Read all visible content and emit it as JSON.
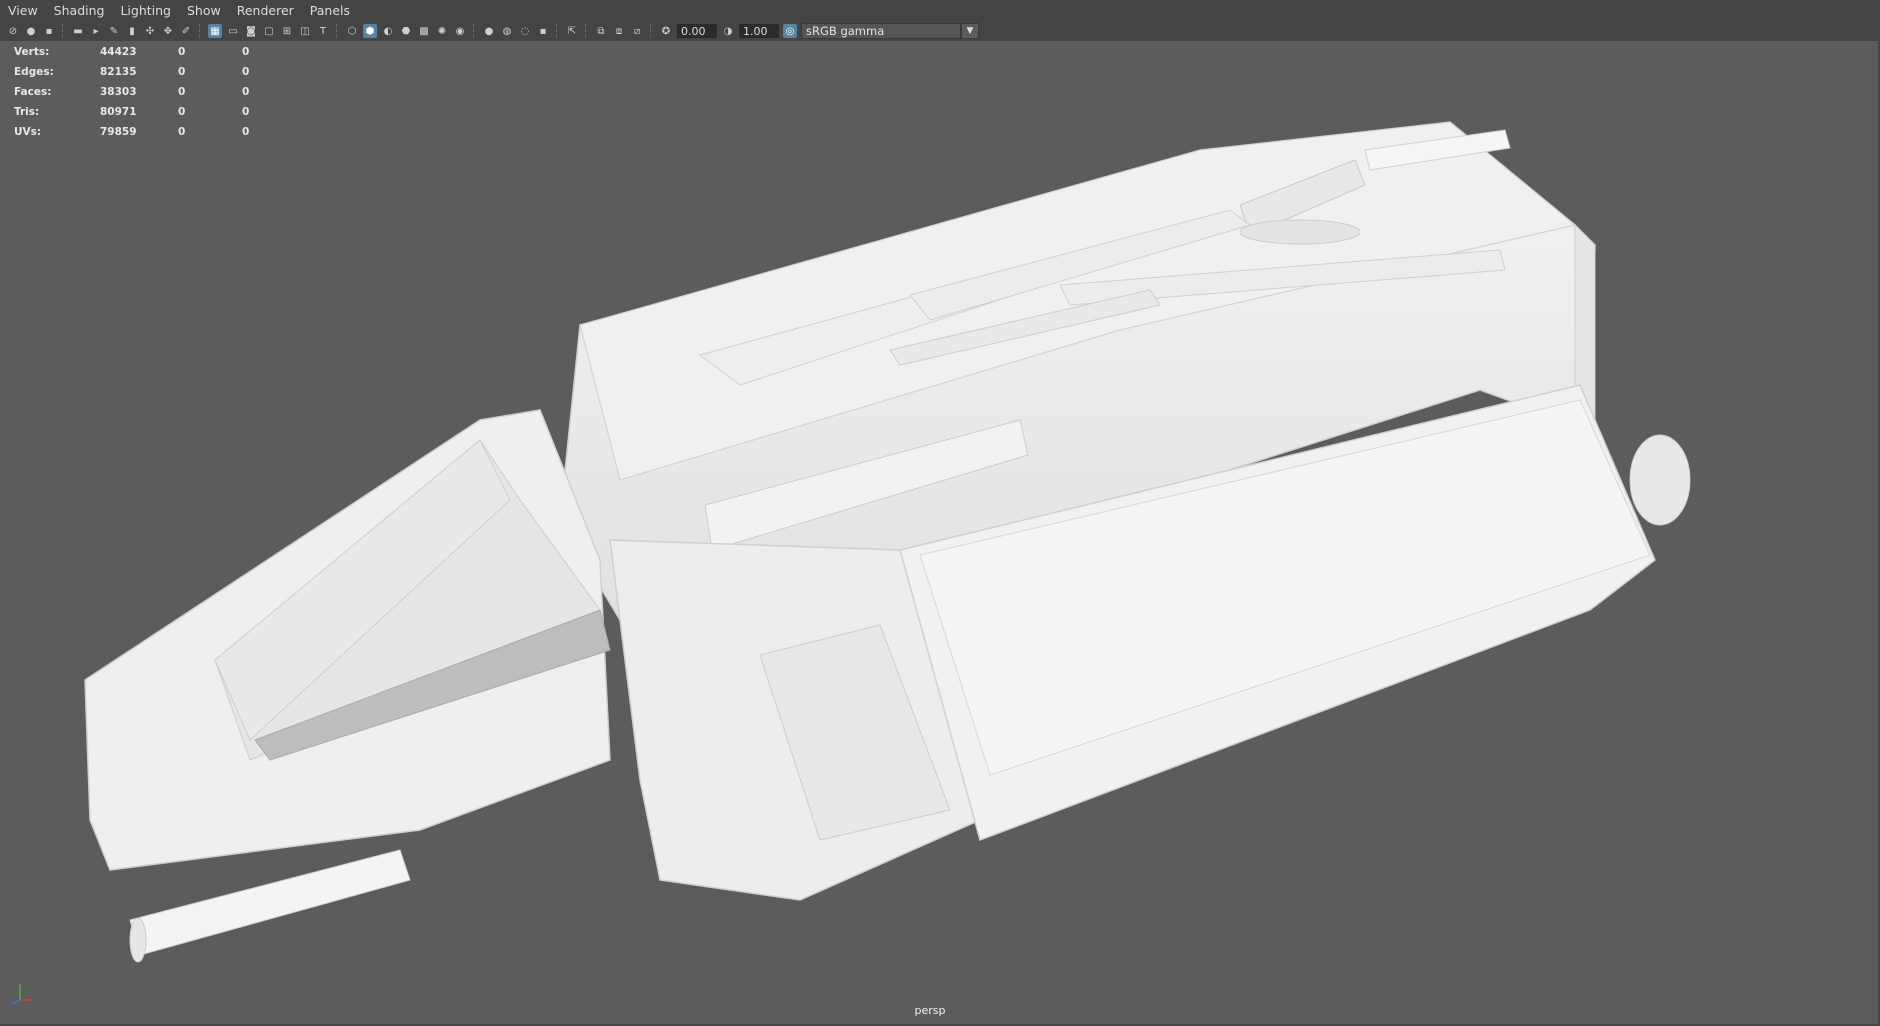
{
  "menu": {
    "items": [
      "View",
      "Shading",
      "Lighting",
      "Show",
      "Renderer",
      "Panels"
    ]
  },
  "toolbar": {
    "icons": [
      "select-camera-icon",
      "camera-attributes-icon",
      "bookmarks-icon",
      "image-plane-icon",
      "two-d-pan-zoom-icon",
      "grease-pencil-icon",
      "grid-icon",
      "film-gate-icon",
      "resolution-gate-icon",
      "gate-mask-icon",
      "field-chart-icon",
      "safe-action-icon",
      "safe-title-icon",
      "wireframe-icon",
      "smooth-shade-icon",
      "default-material-icon",
      "textured-icon",
      "use-all-lights-icon",
      "shadows-icon",
      "screen-space-ao-icon",
      "motion-blur-icon",
      "multisample-aa-icon",
      "depth-of-field-icon",
      "isolate-select-icon",
      "xray-icon",
      "xray-joints-icon",
      "xray-components-icon",
      "exposure-icon",
      "gamma-icon",
      "color-management-icon"
    ],
    "exposure_value": "0.00",
    "gamma_value": "1.00",
    "view_transform": "sRGB gamma"
  },
  "hud": {
    "rows": [
      {
        "label": "Verts:",
        "value": "44423",
        "c1": "0",
        "c2": "0"
      },
      {
        "label": "Edges:",
        "value": "82135",
        "c1": "0",
        "c2": "0"
      },
      {
        "label": "Faces:",
        "value": "38303",
        "c1": "0",
        "c2": "0"
      },
      {
        "label": "Tris:",
        "value": "80971",
        "c1": "0",
        "c2": "0"
      },
      {
        "label": "UVs:",
        "value": "79859",
        "c1": "0",
        "c2": "0"
      }
    ]
  },
  "viewport": {
    "camera_label": "persp",
    "background_color": "#5c5c5c",
    "model_color": "#ececec"
  }
}
